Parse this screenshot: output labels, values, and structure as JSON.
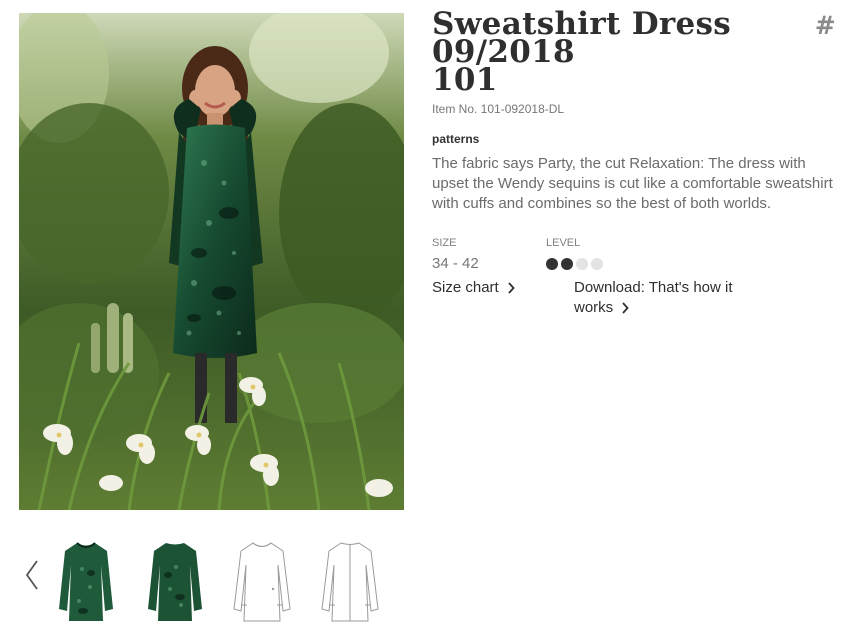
{
  "product": {
    "title": "Sweatshirt Dress 09/2018",
    "number_mark": "#",
    "number": "101",
    "item_no": "Item No. 101-092018-DL",
    "category": "patterns",
    "description": "The fabric says Party, the cut Relaxation: The dress with upset the Wendy sequins is cut like a comfortable sweatshirt with cuffs and combines so the best of both worlds."
  },
  "specs": {
    "size_label": "SIZE",
    "size_value": "34 - 42",
    "level_label": "LEVEL",
    "level": 2,
    "level_max": 4
  },
  "links": {
    "size_chart": "Size chart",
    "download": "Download: That's how it works"
  },
  "gallery": {
    "icons": {
      "prev": "chevron-left-icon",
      "next": "chevron-right-icon"
    },
    "colors": {
      "sequin_green": "#1f5a3a",
      "foliage": "#4e6e32",
      "sketch_line": "#9a9a9a"
    }
  }
}
